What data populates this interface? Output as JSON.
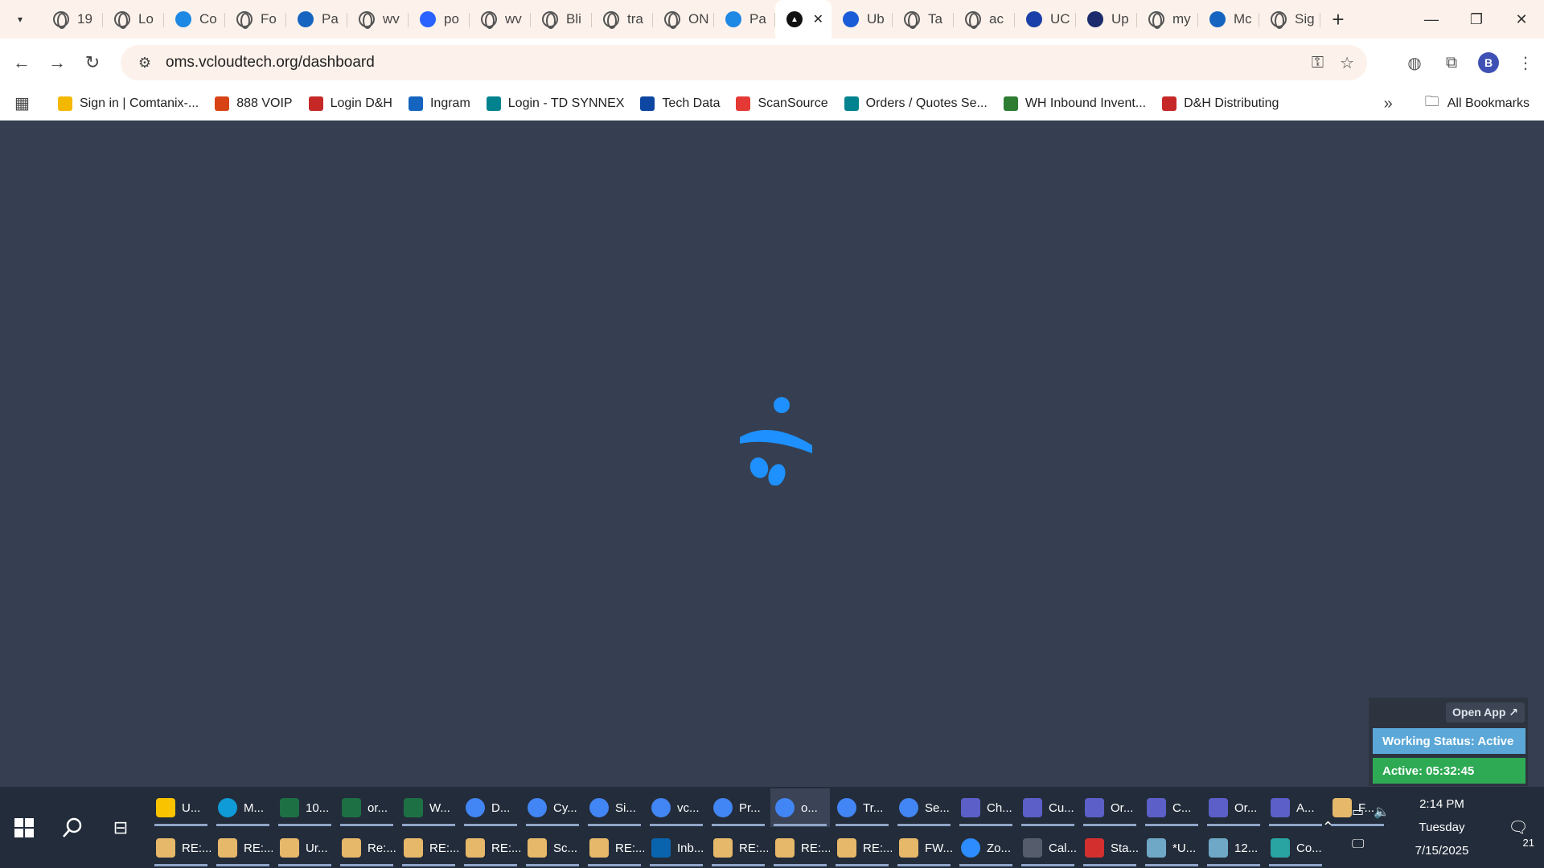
{
  "browser": {
    "tabs": [
      {
        "label": "19",
        "icon": "globe-icon"
      },
      {
        "label": "Lo",
        "icon": "globe-icon"
      },
      {
        "label": "Co",
        "icon": "logi-icon",
        "color": "#1e88e5"
      },
      {
        "label": "Fo",
        "icon": "globe-icon"
      },
      {
        "label": "Pa",
        "icon": "chevron-arrow-icon",
        "color": "#1565c0"
      },
      {
        "label": "wv",
        "icon": "globe-icon"
      },
      {
        "label": "po",
        "icon": "wave-icon",
        "color": "#2962ff"
      },
      {
        "label": "wv",
        "icon": "globe-icon"
      },
      {
        "label": "Bli",
        "icon": "globe-icon"
      },
      {
        "label": "tra",
        "icon": "globe-icon"
      },
      {
        "label": "ON",
        "icon": "globe-icon"
      },
      {
        "label": "Pa",
        "icon": "cloud-icon",
        "color": "#1e88e5"
      },
      {
        "label": "",
        "icon": "vcloud-icon",
        "active": true
      },
      {
        "label": "Ub",
        "icon": "u-icon",
        "color": "#1a5bd8"
      },
      {
        "label": "Ta",
        "icon": "globe-icon"
      },
      {
        "label": "ac",
        "icon": "globe-icon"
      },
      {
        "label": "UC",
        "icon": "pax8-icon",
        "color": "#1a3fa8"
      },
      {
        "label": "Up",
        "icon": "check-icon",
        "color": "#1c2b6b"
      },
      {
        "label": "my",
        "icon": "globe-icon"
      },
      {
        "label": "Mc",
        "icon": "etn-icon",
        "color": "#1565c0"
      },
      {
        "label": "Sig",
        "icon": "globe-icon"
      }
    ],
    "url": "oms.vcloudtech.org/dashboard",
    "profile_initial": "B",
    "bookmarks": [
      {
        "label": "Sign in | Comtanix-...",
        "icon": "w-icon",
        "color": "#f5b800"
      },
      {
        "label": "888 VOIP",
        "icon": "voip-icon",
        "color": "#d84315"
      },
      {
        "label": "Login D&H",
        "icon": "dh-icon",
        "color": "#c62828"
      },
      {
        "label": "Ingram",
        "icon": "ingram-icon",
        "color": "#1565c0"
      },
      {
        "label": "Login - TD SYNNEX",
        "icon": "synnex-icon",
        "color": "#00838f"
      },
      {
        "label": "Tech Data",
        "icon": "techdata-icon",
        "color": "#0d47a1"
      },
      {
        "label": "ScanSource",
        "icon": "scansource-icon",
        "color": "#e53935"
      },
      {
        "label": "Orders / Quotes Se...",
        "icon": "synnex-icon",
        "color": "#00838f"
      },
      {
        "label": "WH Inbound Invent...",
        "icon": "sheets-icon",
        "color": "#2e7d32"
      },
      {
        "label": "D&H Distributing",
        "icon": "dh-icon",
        "color": "#c62828"
      }
    ],
    "all_bookmarks_label": "All Bookmarks"
  },
  "widget": {
    "open_app_label": "Open App ↗",
    "working_status": "Working Status: Active",
    "active_timer": "Active: 05:32:45",
    "status_color": "#5ba8d8",
    "active_color": "#2eaa55"
  },
  "taskbar": {
    "row1": [
      {
        "label": "U...",
        "icon": "explorer-icon",
        "color": "#f9c300"
      },
      {
        "label": "M...",
        "icon": "edge-icon",
        "color": "#0f9bd7"
      },
      {
        "label": "10...",
        "icon": "excel-icon",
        "color": "#1d7044"
      },
      {
        "label": "or...",
        "icon": "excel-icon",
        "color": "#1d7044"
      },
      {
        "label": "W...",
        "icon": "excel-icon",
        "color": "#1d7044"
      },
      {
        "label": "D...",
        "icon": "chrome-icon",
        "color": "#4285f4"
      },
      {
        "label": "Cy...",
        "icon": "chrome-icon",
        "color": "#4285f4"
      },
      {
        "label": "Si...",
        "icon": "chrome-icon",
        "color": "#4285f4"
      },
      {
        "label": "vc...",
        "icon": "chrome-icon",
        "color": "#4285f4"
      },
      {
        "label": "Pr...",
        "icon": "chrome-icon",
        "color": "#4285f4"
      },
      {
        "label": "o...",
        "icon": "chrome-icon",
        "color": "#4285f4",
        "active": true
      },
      {
        "label": "Tr...",
        "icon": "chrome-icon",
        "color": "#4285f4"
      },
      {
        "label": "Se...",
        "icon": "chrome-icon",
        "color": "#4285f4"
      },
      {
        "label": "Ch...",
        "icon": "teams-icon",
        "color": "#5b5fc7"
      },
      {
        "label": "Cu...",
        "icon": "teams-icon",
        "color": "#5b5fc7"
      },
      {
        "label": "Or...",
        "icon": "teams-icon",
        "color": "#5b5fc7"
      },
      {
        "label": "C...",
        "icon": "teams-icon",
        "color": "#5b5fc7"
      },
      {
        "label": "Or...",
        "icon": "teams-icon",
        "color": "#5b5fc7"
      },
      {
        "label": "A...",
        "icon": "teams-icon",
        "color": "#5b5fc7"
      },
      {
        "label": "F...",
        "icon": "mail-icon",
        "color": "#e6b86a"
      }
    ],
    "row2": [
      {
        "label": "RE:...",
        "icon": "mail-icon",
        "color": "#e6b86a"
      },
      {
        "label": "RE:...",
        "icon": "mail-icon",
        "color": "#e6b86a"
      },
      {
        "label": "Ur...",
        "icon": "mail-icon",
        "color": "#e6b86a"
      },
      {
        "label": "Re:...",
        "icon": "mail-icon",
        "color": "#e6b86a"
      },
      {
        "label": "RE:...",
        "icon": "mail-icon",
        "color": "#e6b86a"
      },
      {
        "label": "RE:...",
        "icon": "mail-icon",
        "color": "#e6b86a"
      },
      {
        "label": "Sc...",
        "icon": "mail-icon",
        "color": "#e6b86a"
      },
      {
        "label": "RE:...",
        "icon": "mail-icon",
        "color": "#e6b86a"
      },
      {
        "label": "Inb...",
        "icon": "outlook-icon",
        "color": "#0a64ad"
      },
      {
        "label": "RE:...",
        "icon": "mail-icon",
        "color": "#e6b86a"
      },
      {
        "label": "RE:...",
        "icon": "mail-icon",
        "color": "#e6b86a"
      },
      {
        "label": "RE:...",
        "icon": "mail-icon",
        "color": "#e6b86a"
      },
      {
        "label": "FW...",
        "icon": "mail-icon",
        "color": "#e6b86a"
      },
      {
        "label": "Zo...",
        "icon": "zoom-icon",
        "color": "#2d8cff"
      },
      {
        "label": "Cal...",
        "icon": "calculator-icon",
        "color": "#555c6b"
      },
      {
        "label": "Sta...",
        "icon": "pdf-icon",
        "color": "#d32f2f"
      },
      {
        "label": "*U...",
        "icon": "notepad-icon",
        "color": "#6fa8c6"
      },
      {
        "label": "12...",
        "icon": "notepad-icon",
        "color": "#6fa8c6"
      },
      {
        "label": "Co...",
        "icon": "app-icon",
        "color": "#2aa3a3"
      }
    ],
    "time": "2:14 PM",
    "day": "Tuesday",
    "date": "7/15/2025",
    "notification_count": "21"
  },
  "colors": {
    "page_bg": "#353f51",
    "spinner": "#1e90ff",
    "tabstrip_bg": "#fdf2eb"
  }
}
